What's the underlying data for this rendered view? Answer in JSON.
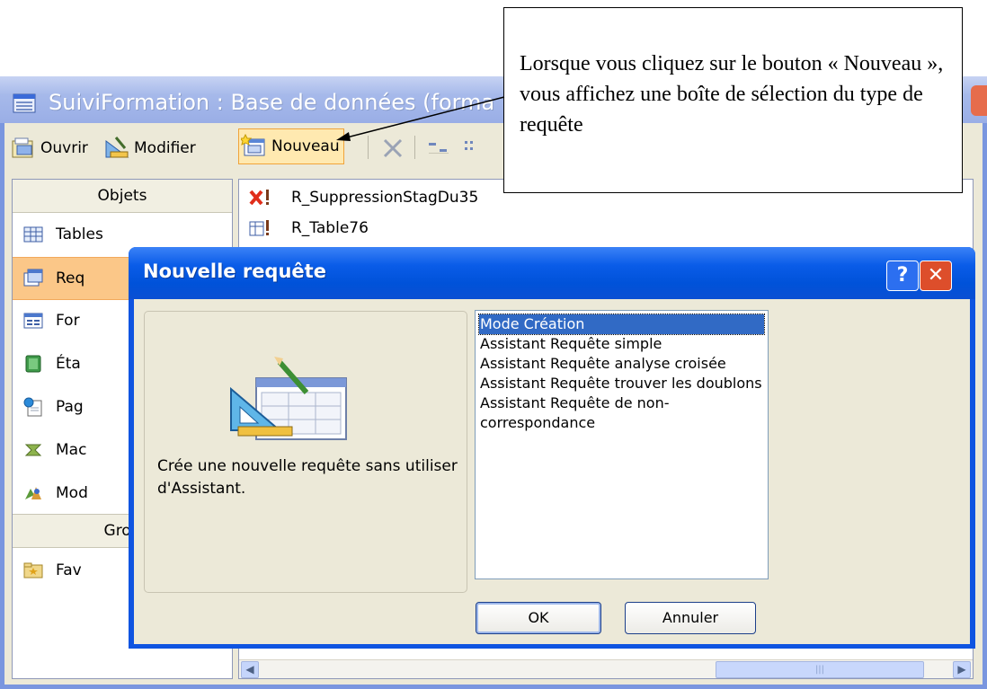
{
  "main_window": {
    "title": "SuiviFormation : Base de données (forma"
  },
  "toolbar": {
    "open_label": "Ouvrir",
    "modify_label": "Modifier",
    "new_label": "Nouveau"
  },
  "objects_pane": {
    "objects_header": "Objets",
    "items": [
      {
        "label": "Tables",
        "icon": "table-icon"
      },
      {
        "label": "Req",
        "icon": "query-icon",
        "selected": true
      },
      {
        "label": "For",
        "icon": "form-icon"
      },
      {
        "label": "Éta",
        "icon": "report-icon"
      },
      {
        "label": "Pag",
        "icon": "page-icon"
      },
      {
        "label": "Mac",
        "icon": "macro-icon"
      },
      {
        "label": "Mod",
        "icon": "module-icon"
      }
    ],
    "groups_header": "Grou",
    "favorites_label": "Fav"
  },
  "list_pane": {
    "items": [
      {
        "label": "R_SuppressionStagDu35",
        "icon": "delete-query-icon"
      },
      {
        "label": "R_Table76",
        "icon": "make-table-query-icon"
      }
    ]
  },
  "dialog": {
    "title": "Nouvelle requête",
    "help_glyph": "?",
    "close_glyph": "✕",
    "description": "Crée une nouvelle requête sans utiliser d'Assistant.",
    "types": [
      "Mode Création",
      "Assistant Requête simple",
      "Assistant Requête analyse croisée",
      "Assistant Requête trouver les doublons",
      "Assistant Requête de non-correspondance"
    ],
    "selected_type": "Mode Création",
    "ok_label": "OK",
    "cancel_label": "Annuler"
  },
  "callout": {
    "text": "Lorsque vous cliquez sur le bouton « Nouveau », vous affichez une boîte de sélection du type de requête"
  },
  "colors": {
    "dialog_title": "#0a5ce8",
    "selection": "#316ac5",
    "object_selected": "#fbc788",
    "window_body": "#ece9d8"
  }
}
